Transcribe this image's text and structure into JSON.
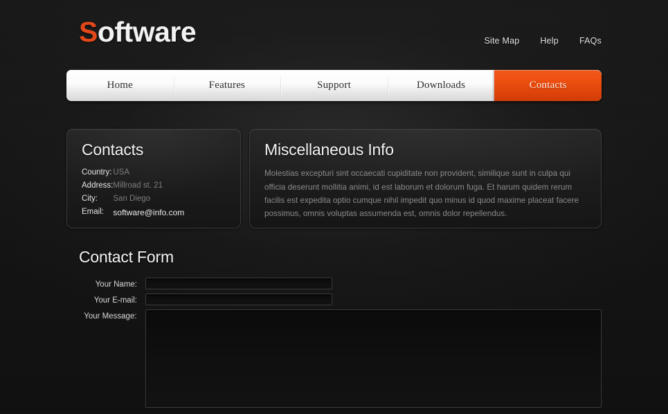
{
  "site": {
    "logo_accent": "S",
    "logo_rest": "oftware",
    "accent_color": "#e2471a"
  },
  "header": {
    "toplinks": [
      {
        "label": "Site Map"
      },
      {
        "label": "Help"
      },
      {
        "label": "FAQs"
      }
    ]
  },
  "mainnav": {
    "items": [
      {
        "label": "Home",
        "active": false
      },
      {
        "label": "Features",
        "active": false
      },
      {
        "label": "Support",
        "active": false
      },
      {
        "label": "Downloads",
        "active": false
      },
      {
        "label": "Contacts",
        "active": true
      }
    ],
    "active_color": "#ed4f10"
  },
  "contacts_panel": {
    "title": "Contacts",
    "rows": [
      {
        "label": "Country:",
        "value": "USA",
        "is_link": false
      },
      {
        "label": "Address:",
        "value": "Millroad st. 21",
        "is_link": false
      },
      {
        "label": "City:",
        "value": "San Diego",
        "is_link": false
      },
      {
        "label": "Email:",
        "value": "software@info.com",
        "is_link": true
      }
    ]
  },
  "misc_panel": {
    "title": "Miscellaneous Info",
    "body": "Molestias excepturi sint occaecati cupiditate non provident, similique sunt in culpa qui officia deserunt mollitia animi, id est laborum et dolorum fuga. Et harum quidem rerum facilis est expedita optio cumque nihil impedit quo minus id quod maxime placeat facere possimus, omnis voluptas assumenda est, omnis dolor repellendus."
  },
  "contact_form": {
    "title": "Contact Form",
    "fields": [
      {
        "label": "Your Name:",
        "value": "",
        "placeholder": "",
        "type": "text"
      },
      {
        "label": "Your E-mail:",
        "value": "",
        "placeholder": "",
        "type": "text"
      },
      {
        "label": "Your Message:",
        "value": "",
        "placeholder": "",
        "type": "textarea"
      }
    ]
  }
}
